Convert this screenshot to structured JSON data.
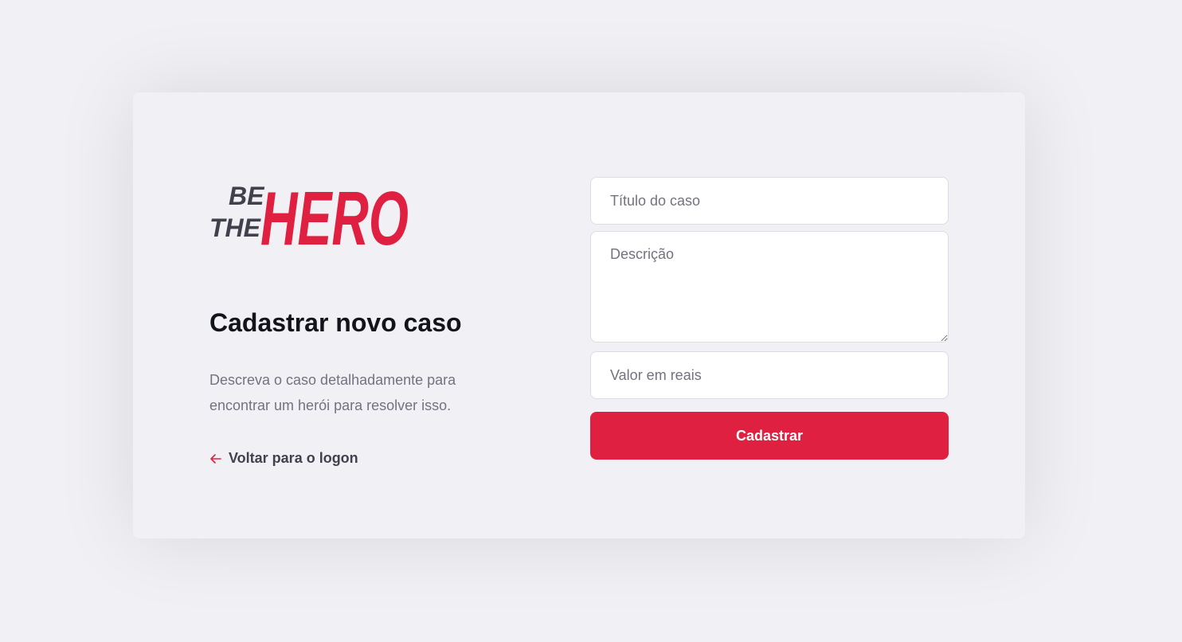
{
  "logo": {
    "line1": "BE",
    "line2": "THE",
    "line3": "HERO",
    "colors": {
      "be_the": "#41414d",
      "hero": "#e02041"
    }
  },
  "page": {
    "title": "Cadastrar novo caso",
    "description": "Descreva o caso detalhadamente para encontrar um herói para resolver isso.",
    "back_link": "Voltar para o logon",
    "back_icon": "arrow-left-icon"
  },
  "form": {
    "title_placeholder": "Título do caso",
    "title_value": "",
    "description_placeholder": "Descrição",
    "description_value": "",
    "value_placeholder": "Valor em reais",
    "value_value": "",
    "submit_label": "Cadastrar"
  },
  "colors": {
    "background": "#f0f0f5",
    "accent": "#e02041",
    "heading": "#13131a",
    "muted": "#737380",
    "link": "#41414d"
  }
}
